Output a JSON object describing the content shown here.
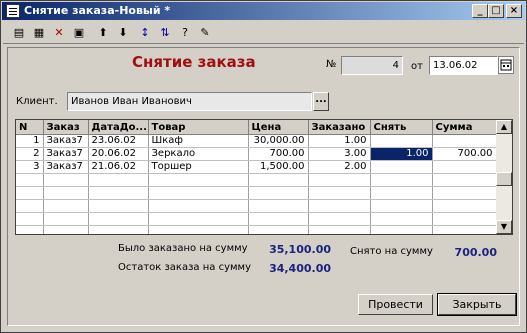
{
  "window": {
    "title": "Снятие заказа-Новый *"
  },
  "toolbar": {
    "icons": [
      "save-icon",
      "save-copy-icon",
      "delete-row-icon",
      "print-icon",
      "move-up-icon",
      "move-down-icon",
      "sort-asc-icon",
      "sort-desc-icon",
      "help-icon",
      "tools-icon"
    ]
  },
  "form": {
    "heading": "Снятие заказа",
    "number_label": "№",
    "number_value": "4",
    "of_label": "от",
    "date_value": "13.06.02",
    "client_label": "Клиент.",
    "client_value": "Иванов Иван Иванович",
    "pick_label": "..."
  },
  "table": {
    "columns": [
      "N",
      "Заказ",
      "ДатаДо...",
      "Товар",
      "Цена",
      "Заказано",
      "Снять",
      "Сумма"
    ],
    "rows": [
      {
        "n": "1",
        "order": "Заказ7",
        "date": "23.06.02",
        "item": "Шкаф",
        "price": "30,000.00",
        "ordered": "1.00",
        "take": "",
        "sum": ""
      },
      {
        "n": "2",
        "order": "Заказ7",
        "date": "20.06.02",
        "item": "Зеркало",
        "price": "700.00",
        "ordered": "3.00",
        "take": "1.00",
        "sum": "700.00"
      },
      {
        "n": "3",
        "order": "Заказ7",
        "date": "21.06.02",
        "item": "Торшер",
        "price": "1,500.00",
        "ordered": "2.00",
        "take": "",
        "sum": ""
      }
    ]
  },
  "totals": {
    "ordered_label": "Было заказано на сумму",
    "ordered_value": "35,100.00",
    "removed_label": "Снято на сумму",
    "removed_value": "700.00",
    "remaining_label": "Остаток заказа на сумму",
    "remaining_value": "34,400.00"
  },
  "buttons": {
    "post": "Провести",
    "close": "Закрыть"
  }
}
